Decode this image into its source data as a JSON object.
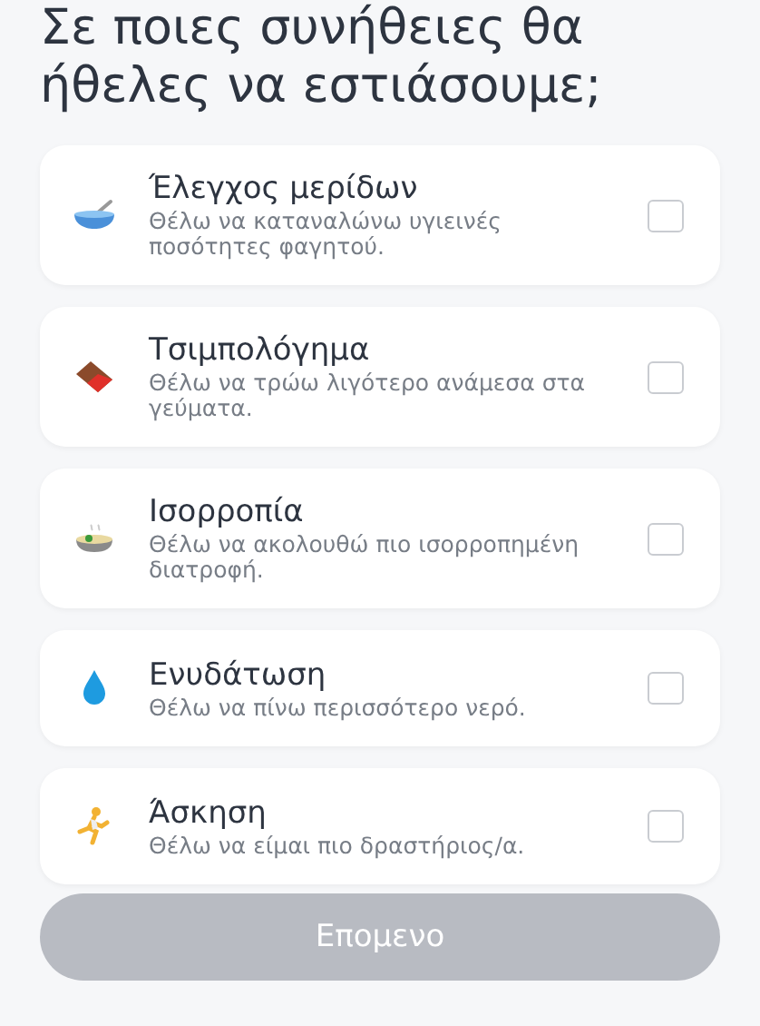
{
  "title": "Σε ποιες συνήθειες θα ήθελες να εστιάσουμε;",
  "options": [
    {
      "title": "Έλεγχος μερίδων",
      "description": "Θέλω να καταναλώνω υγιεινές ποσότητες φαγητού.",
      "checked": false
    },
    {
      "title": "Τσιμπολόγημα",
      "description": "Θέλω να τρώω λιγότερο ανάμεσα στα γεύματα.",
      "checked": false
    },
    {
      "title": "Ισορροπία",
      "description": "Θέλω να ακολουθώ πιο ισορροπημένη διατροφή.",
      "checked": false
    },
    {
      "title": "Ενυδάτωση",
      "description": "Θέλω να πίνω περισσότερο νερό.",
      "checked": false
    },
    {
      "title": "Άσκηση",
      "description": "Θέλω να είμαι πιο δραστήριος/α.",
      "checked": false
    }
  ],
  "next_button": {
    "label": "Επομενο",
    "disabled": true
  }
}
